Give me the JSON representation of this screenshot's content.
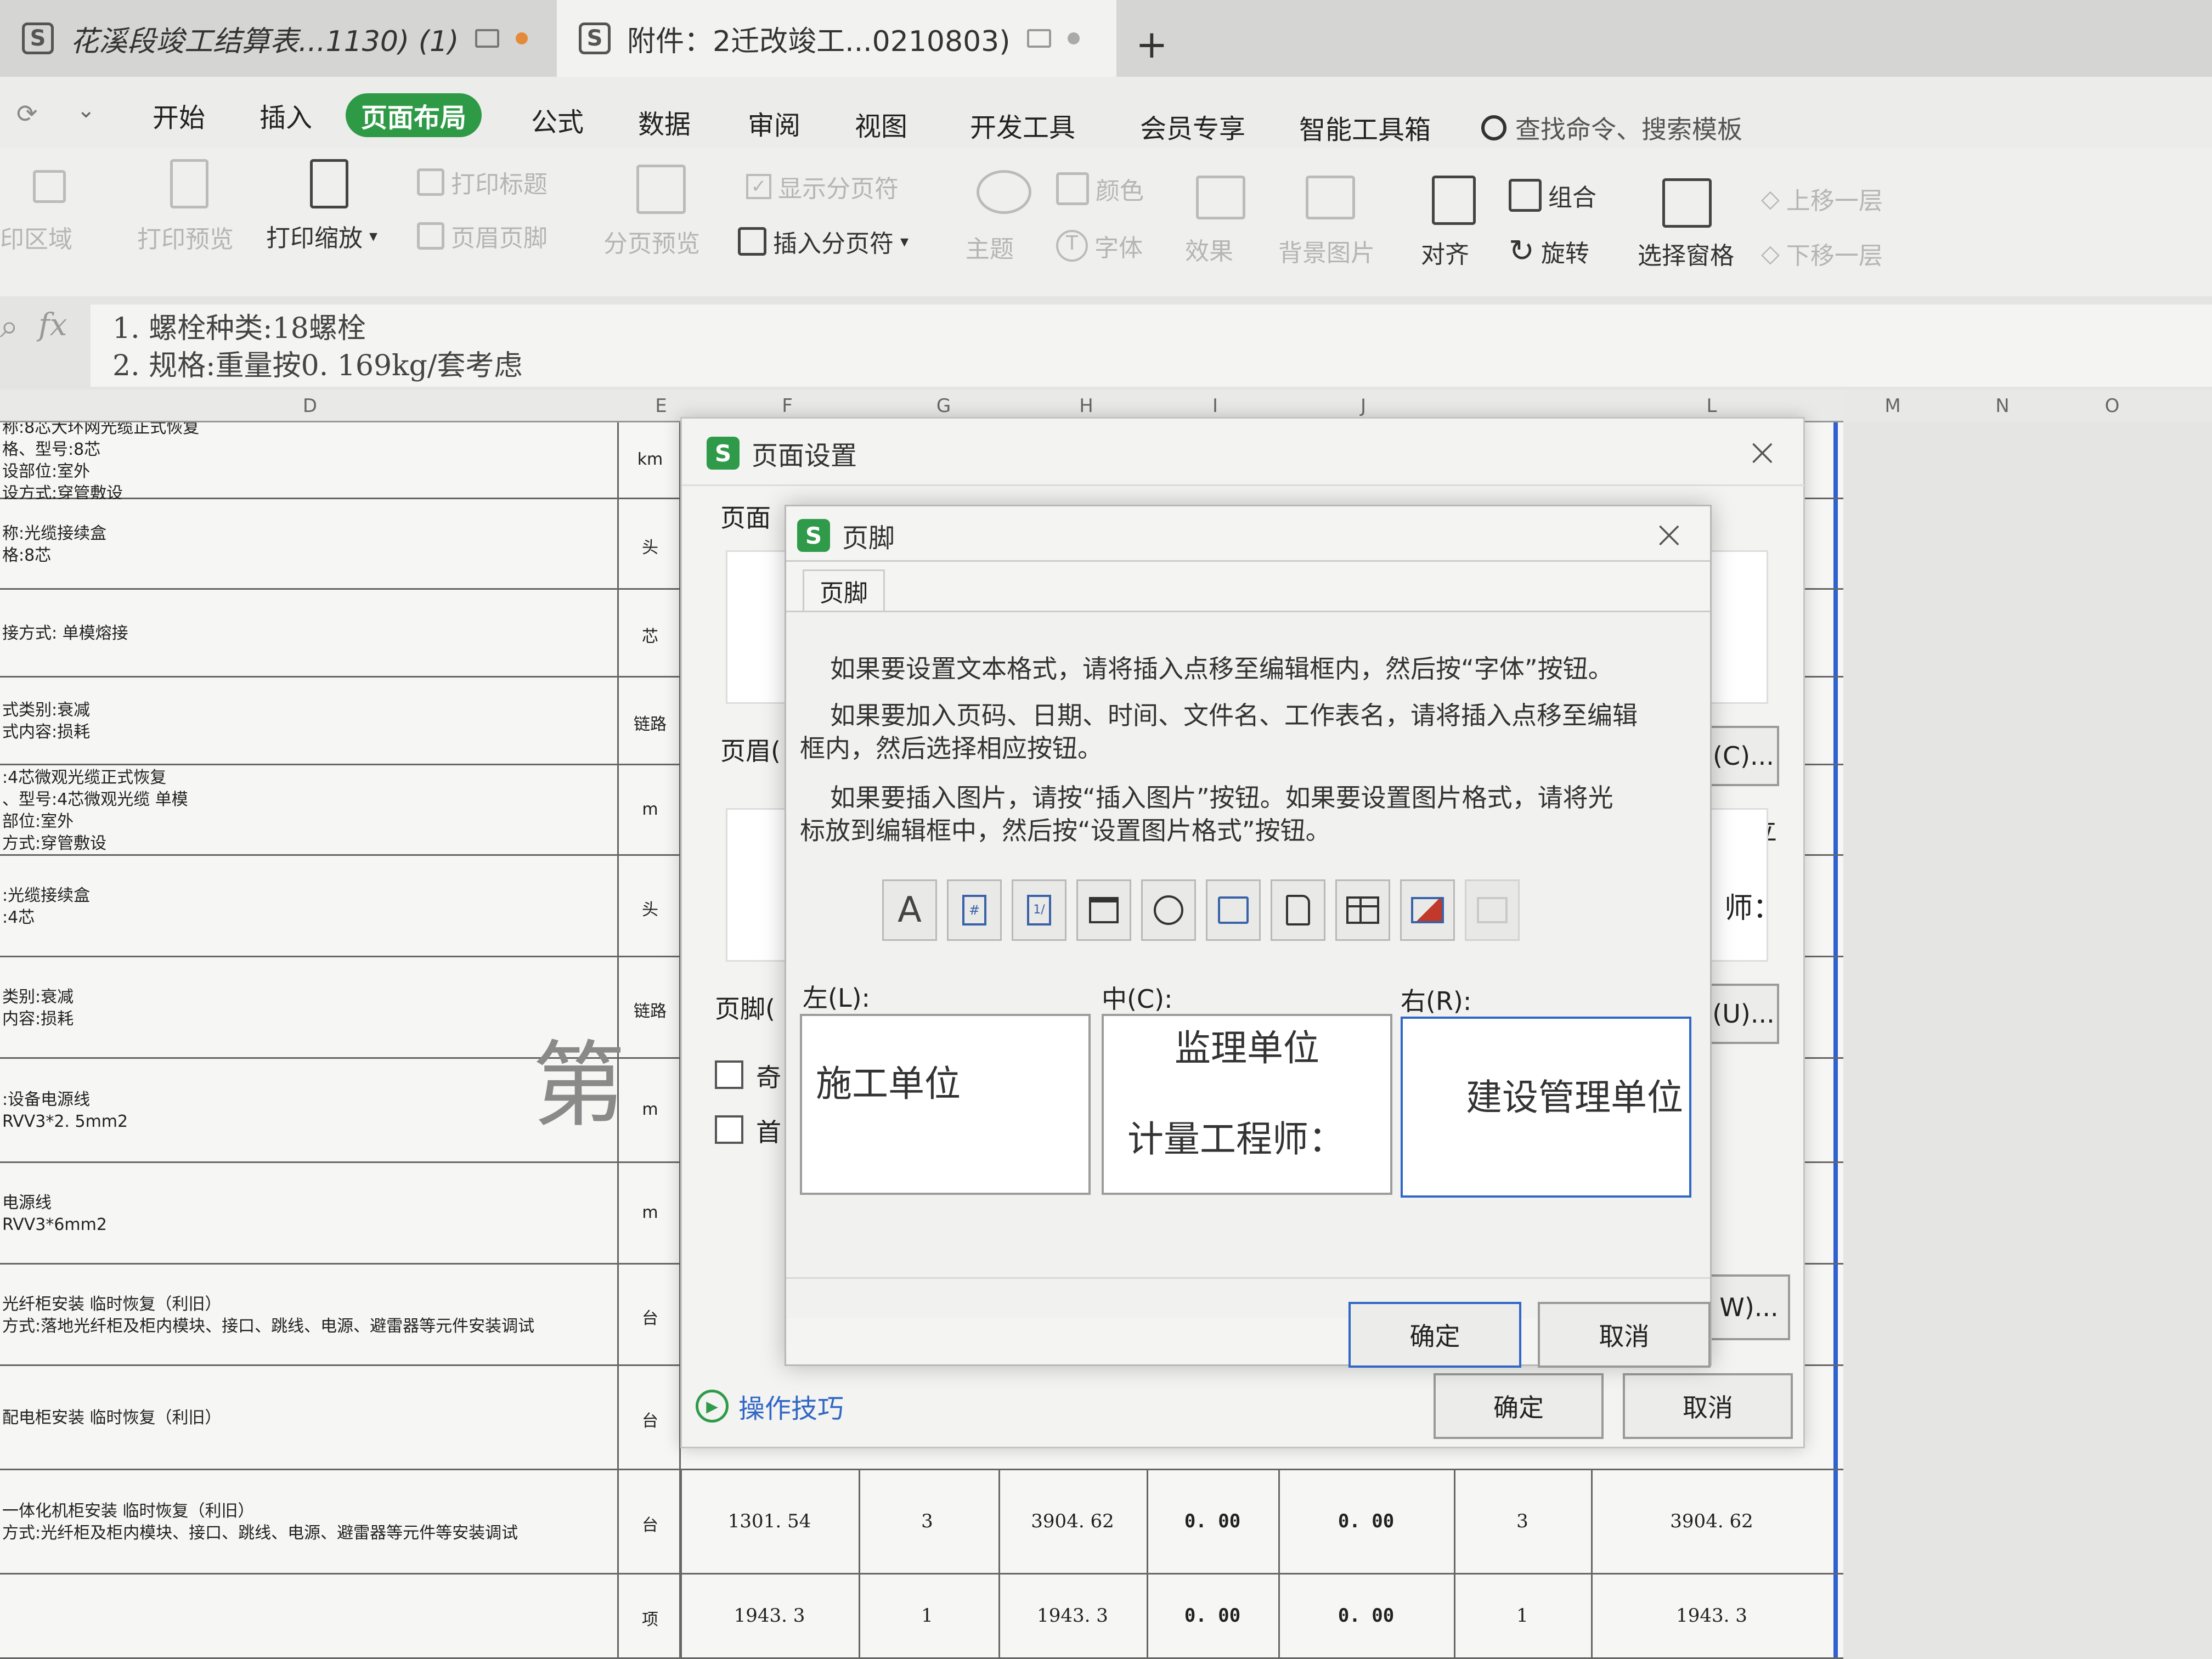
{
  "tabs": [
    {
      "title": "花溪段竣工结算表...1130) (1)"
    },
    {
      "title": "附件：2迁改竣工...0210803)"
    }
  ],
  "new_tab": "+",
  "menu": [
    "开始",
    "插入",
    "页面布局",
    "公式",
    "数据",
    "审阅",
    "视图",
    "开发工具",
    "会员专享",
    "智能工具箱"
  ],
  "search": {
    "placeholder": "查找命令、搜索模板"
  },
  "ribbon": {
    "print_area": "印区域",
    "print_preview": "打印预览",
    "print_scale": "打印缩放",
    "print_title": "打印标题",
    "header_footer": "页眉页脚",
    "page_break_preview": "分页预览",
    "show_page_breaks": "显示分页符",
    "insert_page_break": "插入分页符",
    "theme": "主题",
    "colors": "颜色",
    "font": "字体",
    "effects": "效果",
    "background": "背景图片",
    "align": "对齐",
    "group": "组合",
    "rotate": "旋转",
    "selection_pane": "选择窗格",
    "bring_forward": "上移一层",
    "send_backward": "下移一层"
  },
  "formula": {
    "fx": "fx",
    "line1": "1. 螺栓种类:18螺栓",
    "line2": "2. 规格:重量按0. 169kg/套考虑"
  },
  "columns": [
    "D",
    "E",
    "F",
    "G",
    "H",
    "I",
    "J",
    "L",
    "M",
    "N",
    "O"
  ],
  "rows": [
    {
      "desc": [
        "称:8芯大环网光缆正式恢复",
        "格、型号:8芯",
        "设部位:室外",
        "设方式:穿管敷设"
      ],
      "unit": "km"
    },
    {
      "desc": [
        "称:光缆接续盒",
        "格:8芯"
      ],
      "unit": "头"
    },
    {
      "desc": [
        "接方式: 单模熔接"
      ],
      "unit": "芯"
    },
    {
      "desc": [
        "式类别:衰减",
        "式内容:损耗"
      ],
      "unit": "链路"
    },
    {
      "desc": [
        ":4芯微观光缆正式恢复",
        "、型号:4芯微观光缆 单模",
        "部位:室外",
        "方式:穿管敷设"
      ],
      "unit": "m"
    },
    {
      "desc": [
        ":光缆接续盒",
        ":4芯"
      ],
      "unit": "头"
    },
    {
      "desc": [
        "类别:衰减",
        "内容:损耗"
      ],
      "unit": "链路"
    },
    {
      "desc": [
        ":设备电源线",
        "RVV3*2. 5mm2"
      ],
      "unit": "m"
    },
    {
      "desc": [
        "电源线",
        "RVV3*6mm2"
      ],
      "unit": "m"
    },
    {
      "desc": [
        "光纤柜安装 临时恢复（利旧）",
        "方式:落地光纤柜及柜内模块、接口、跳线、电源、避雷器等元件安装调试"
      ],
      "unit": "台"
    },
    {
      "desc": [
        "配电柜安装 临时恢复（利旧）"
      ],
      "unit": "台"
    },
    {
      "desc": [
        "一体化机柜安装 临时恢复（利旧）",
        "方式:光纤柜及柜内模块、接口、跳线、电源、避雷器等元件等安装调试"
      ],
      "unit": "台",
      "vals": [
        "1301. 54",
        "3",
        "3904. 62",
        "0. 00",
        "0. 00",
        "3",
        "3904. 62"
      ]
    },
    {
      "desc": [
        ""
      ],
      "unit": "项",
      "vals": [
        "1943. 3",
        "1",
        "1943. 3",
        "0. 00",
        "0. 00",
        "1",
        "1943. 3"
      ]
    }
  ],
  "watermark": "第",
  "page_setup": {
    "title": "页面设置",
    "tab_page": "页面",
    "header_label": "页眉(",
    "footer_label": "页脚(",
    "odd_even": "奇",
    "first_page": "首",
    "btn_c": "(C)...",
    "btn_u": "(U)...",
    "btn_w": "W)...",
    "peek1": "立",
    "peek2": "师：",
    "tips": "操作技巧",
    "ok": "确定",
    "cancel": "取消"
  },
  "footer_dialog": {
    "title": "页脚",
    "tab": "页脚",
    "para1": "如果要设置文本格式，请将插入点移至编辑框内，然后按“字体”按钮。",
    "para2a": "如果要加入页码、日期、时间、文件名、工作表名，请将插入点移至编辑",
    "para2b": "框内，然后选择相应按钮。",
    "para3a": "如果要插入图片，请按“插入图片”按钮。如果要设置图片格式，请将光",
    "para3b": "标放到编辑框中，然后按“设置图片格式”按钮。",
    "left_label": "左(L):",
    "center_label": "中(C):",
    "right_label": "右(R):",
    "left_text": "施工单位",
    "center_line1": "监理单位",
    "center_line2": "计量工程师：",
    "right_text": "建设管理单位",
    "ok": "确定",
    "cancel": "取消"
  },
  "toolbar_icons": [
    "font-icon",
    "page-number-icon",
    "total-pages-icon",
    "date-icon",
    "time-icon",
    "file-path-icon",
    "file-name-icon",
    "sheet-name-icon",
    "insert-picture-icon",
    "format-picture-icon"
  ],
  "colors": {
    "accent_green": "#2e9a46",
    "focus_blue": "#3167c7"
  }
}
